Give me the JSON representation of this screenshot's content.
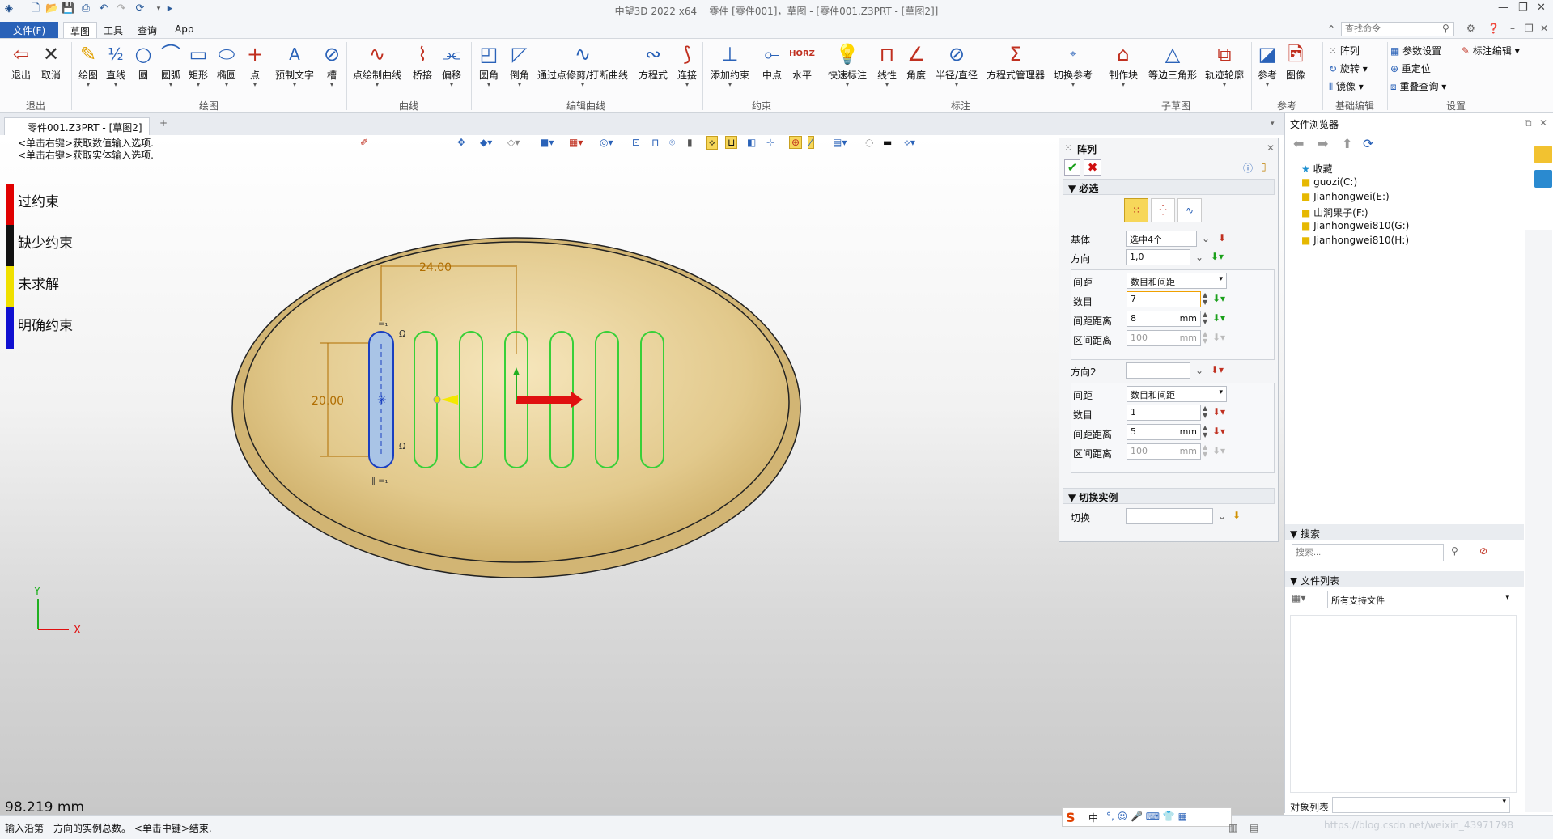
{
  "titlebar": {
    "app": "中望3D 2022 x64",
    "doc": "零件 [零件001]，草图 - [零件001.Z3PRT - [草图2]]"
  },
  "menu": {
    "file": "文件(F)",
    "tabs": [
      "草图",
      "工具",
      "查询",
      "App"
    ]
  },
  "search": {
    "placeholder": "查找命令"
  },
  "ribbon": {
    "exit": [
      "退出",
      "取消"
    ],
    "draw": [
      "绘图",
      "直线",
      "圆",
      "圆弧",
      "矩形",
      "椭圆",
      "点",
      "预制文字",
      "槽"
    ],
    "curve": [
      "点绘制曲线",
      "桥接",
      "偏移"
    ],
    "edit": [
      "圆角",
      "倒角",
      "通过点修剪/打断曲线",
      "方程式",
      "连接"
    ],
    "constraint": [
      "添加约束",
      "中点",
      "水平"
    ],
    "dim": [
      "快速标注",
      "线性",
      "角度",
      "半径/直径",
      "方程式管理器",
      "切换参考"
    ],
    "sub": [
      "制作块",
      "等边三角形",
      "轨迹轮廓"
    ],
    "ref": [
      "参考",
      "图像"
    ],
    "base": [
      "阵列",
      "旋转",
      "镜像"
    ],
    "settings": [
      "参数设置",
      "重定位",
      "重叠查询",
      "标注编辑"
    ],
    "group_labels": [
      "退出",
      "绘图",
      "曲线",
      "编辑曲线",
      "约束",
      "标注",
      "子草图",
      "参考",
      "基础编辑",
      "设置"
    ],
    "horz_icon": "HORZ"
  },
  "doc_tab": "零件001.Z3PRT - [草图2]",
  "hints": [
    "<单击右键>获取数值输入选项.",
    "<单击右键>获取实体输入选项."
  ],
  "legend": [
    {
      "label": "过约束",
      "color": "#e00000"
    },
    {
      "label": "缺少约束",
      "color": "#111111"
    },
    {
      "label": "未求解",
      "color": "#f0e000"
    },
    {
      "label": "明确约束",
      "color": "#1010d0"
    }
  ],
  "dims": {
    "h": "24.00",
    "v": "20.00"
  },
  "distance": "98.219 mm",
  "axis": {
    "x": "X",
    "y": "Y"
  },
  "array": {
    "title": "阵列",
    "required": "必选",
    "base": {
      "label": "基体",
      "value": "选中4个"
    },
    "dir": {
      "label": "方向",
      "value": "1,0"
    },
    "spacing": {
      "label": "间距",
      "value": "数目和间距"
    },
    "count": {
      "label": "数目",
      "value": "7"
    },
    "pitch": {
      "label": "间距距离",
      "value": "8",
      "unit": "mm"
    },
    "region": {
      "label": "区间距离",
      "value": "100",
      "unit": "mm"
    },
    "dir2": {
      "label": "方向2",
      "value": ""
    },
    "spacing2": {
      "label": "间距",
      "value": "数目和间距"
    },
    "count2": {
      "label": "数目",
      "value": "1"
    },
    "pitch2": {
      "label": "间距距离",
      "value": "5",
      "unit": "mm"
    },
    "region2": {
      "label": "区间距离",
      "value": "100",
      "unit": "mm"
    },
    "toggle_sec": "切换实例",
    "toggle": {
      "label": "切换",
      "value": ""
    }
  },
  "browser": {
    "title": "文件浏览器",
    "tree": [
      "收藏",
      "guozi(C:)",
      "Jianhongwei(E:)",
      "山涧果子(F:)",
      "Jianhongwei810(G:)",
      "Jianhongwei810(H:)"
    ],
    "search_sec": "搜索",
    "search_placeholder": "搜索...",
    "filelist_sec": "文件列表",
    "filter": "所有支持文件",
    "objects": "对象列表"
  },
  "status": {
    "left": "输入沿第一方向的实例总数。 <单击中键>结束.",
    "watermark": "https://blog.csdn.net/weixin_43971798",
    "ime": "中"
  }
}
